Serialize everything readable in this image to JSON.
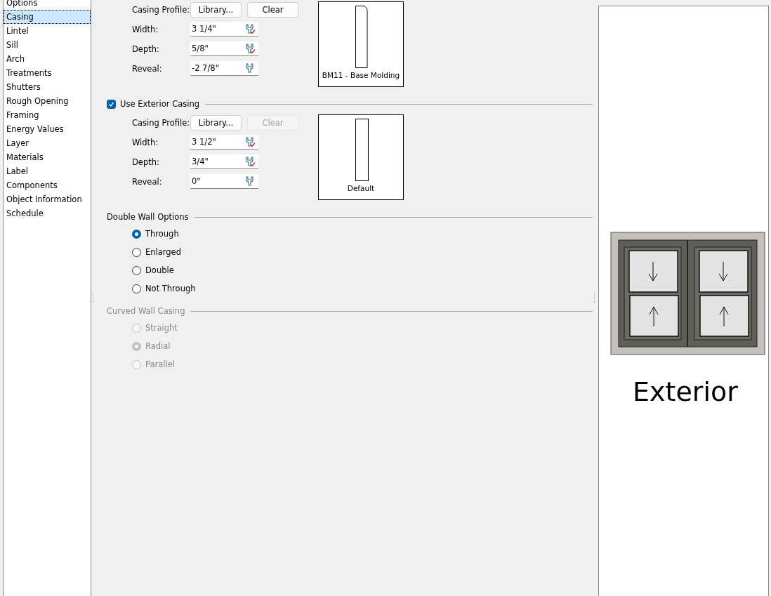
{
  "sidebar": {
    "items": [
      {
        "label": "Options",
        "selected": false
      },
      {
        "label": "Casing",
        "selected": true
      },
      {
        "label": "Lintel",
        "selected": false
      },
      {
        "label": "Sill",
        "selected": false
      },
      {
        "label": "Arch",
        "selected": false
      },
      {
        "label": "Treatments",
        "selected": false
      },
      {
        "label": "Shutters",
        "selected": false
      },
      {
        "label": "Rough Opening",
        "selected": false
      },
      {
        "label": "Framing",
        "selected": false
      },
      {
        "label": "Energy Values",
        "selected": false
      },
      {
        "label": "Layer",
        "selected": false
      },
      {
        "label": "Materials",
        "selected": false
      },
      {
        "label": "Label",
        "selected": false
      },
      {
        "label": "Components",
        "selected": false
      },
      {
        "label": "Object Information",
        "selected": false
      },
      {
        "label": "Schedule",
        "selected": false
      }
    ]
  },
  "casing_groups": [
    {
      "profile_label": "Casing Profile:",
      "library_button": "Library...",
      "clear_button": {
        "label": "Clear",
        "disabled": false
      },
      "fields": [
        {
          "label": "Width:",
          "value": "3 1/4\"",
          "checked": true
        },
        {
          "label": "Depth:",
          "value": "5/8\"",
          "checked": true
        },
        {
          "label": "Reveal:",
          "value": "-2 7/8\"",
          "checked": false
        }
      ],
      "preview": {
        "kind": "molding",
        "caption": "BM11 - Base Molding"
      }
    },
    {
      "header": {
        "label": "Use Exterior Casing",
        "checked": true
      },
      "profile_label": "Casing Profile:",
      "library_button": "Library...",
      "clear_button": {
        "label": "Clear",
        "disabled": true
      },
      "fields": [
        {
          "label": "Width:",
          "value": "3 1/2\"",
          "checked": true
        },
        {
          "label": "Depth:",
          "value": "3/4\"",
          "checked": true
        },
        {
          "label": "Reveal:",
          "value": "0\"",
          "checked": false
        }
      ],
      "preview": {
        "kind": "rect",
        "caption": "Default"
      }
    }
  ],
  "radio_groups": [
    {
      "title": "Double Wall Options",
      "disabled": false,
      "options": [
        {
          "label": "Through",
          "selected": true
        },
        {
          "label": "Enlarged",
          "selected": false
        },
        {
          "label": "Double",
          "selected": false
        },
        {
          "label": "Not Through",
          "selected": false
        }
      ]
    },
    {
      "title": "Curved Wall Casing",
      "disabled": true,
      "options": [
        {
          "label": "Straight",
          "selected": false
        },
        {
          "label": "Radial",
          "selected": true
        },
        {
          "label": "Parallel",
          "selected": false
        }
      ]
    }
  ],
  "preview_panel": {
    "caption": "Exterior"
  }
}
